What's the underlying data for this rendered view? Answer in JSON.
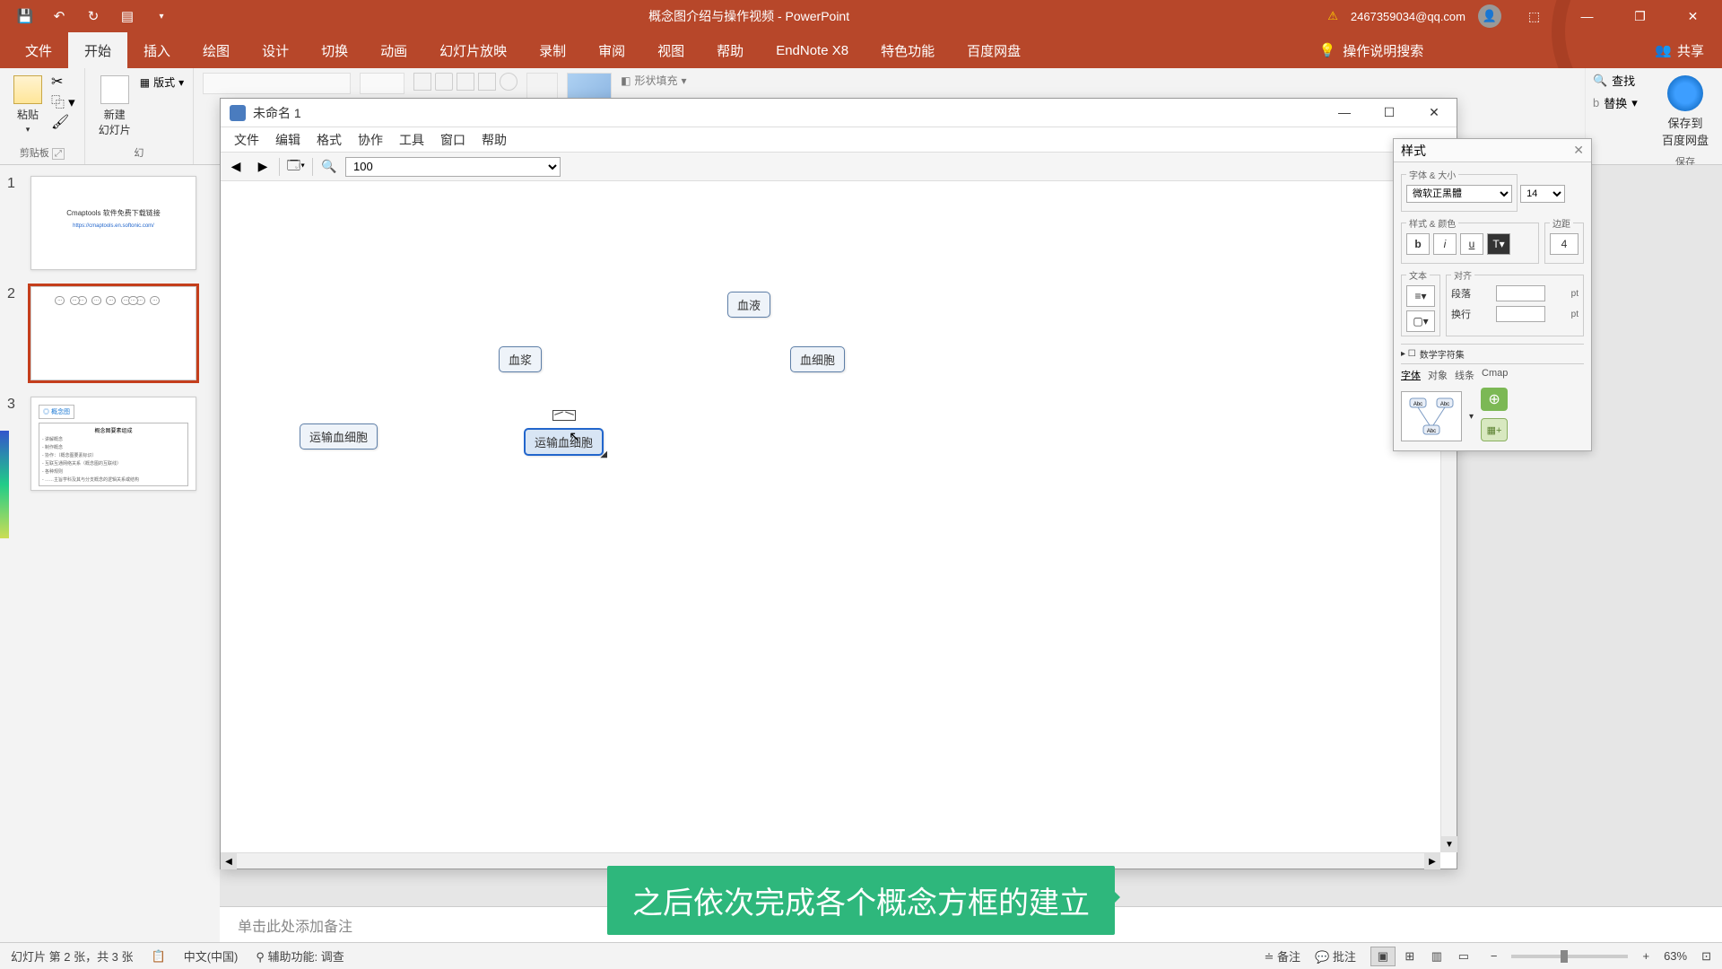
{
  "titlebar": {
    "doc_title": "概念图介绍与操作视频 - PowerPoint",
    "user_email": "2467359034@qq.com"
  },
  "ribbon": {
    "tabs": [
      "文件",
      "开始",
      "插入",
      "绘图",
      "设计",
      "切换",
      "动画",
      "幻灯片放映",
      "录制",
      "审阅",
      "视图",
      "帮助",
      "EndNote X8",
      "特色功能",
      "百度网盘"
    ],
    "search_help": "操作说明搜索",
    "share": "共享",
    "clipboard_label": "剪贴板",
    "paste_label": "粘贴",
    "slides_label": "幻",
    "new_slide": "新建\n幻灯片",
    "layout": "版式",
    "find": "查找",
    "replace": "替换",
    "shape_fill": "形状填充",
    "baidu_save": "保存到\n百度网盘",
    "baidu_group": "保存"
  },
  "thumbnails": {
    "slide1_text": "Cmaptools 软件免费下载链接",
    "slide1_url": "https://cmaptools.en.softonic.com/",
    "slide3_marker": "概念图",
    "slide3_title": "概念图要素组成",
    "slide3_lines": [
      "- 讲解概念",
      "- 制作概念",
      "- 协作：（概念图要素标识）",
      "- 互联互通网络关系（概念图的互联线）",
      "- 各种规则",
      "- ……主旨学科及其与分支概念的逻辑关系或结构"
    ]
  },
  "cmap": {
    "title": "未命名 1",
    "menus": [
      "文件",
      "编辑",
      "格式",
      "协作",
      "工具",
      "窗口",
      "帮助"
    ],
    "zoom": "100",
    "nodes": {
      "n1": "血液",
      "n2": "血浆",
      "n3": "血细胞",
      "n4": "运输血细胞",
      "n5": "运输血细胞"
    }
  },
  "styles": {
    "title": "样式",
    "font_size_label": "字体 & 大小",
    "font_name": "微软正黑體",
    "font_size": "14",
    "style_color_label": "样式 & 颜色",
    "margin_label": "边距",
    "margin_val": "4",
    "text_label": "文本",
    "align_label": "对齐",
    "spacing": "段落",
    "wrap": "换行",
    "pt": "pt",
    "check_label": "数学字符集",
    "tabs": [
      "字体",
      "对象",
      "线条",
      "Cmap"
    ],
    "preview_abc": "Abc"
  },
  "notes": {
    "placeholder": "单击此处添加备注"
  },
  "subtitle": {
    "text": "之后依次完成各个概念方框的建立"
  },
  "statusbar": {
    "slide_info": "幻灯片 第 2 张，共 3 张",
    "language": "中文(中国)",
    "accessibility": "辅助功能: 调查",
    "notes_btn": "备注",
    "comments_btn": "批注",
    "zoom_pct": "63%"
  }
}
